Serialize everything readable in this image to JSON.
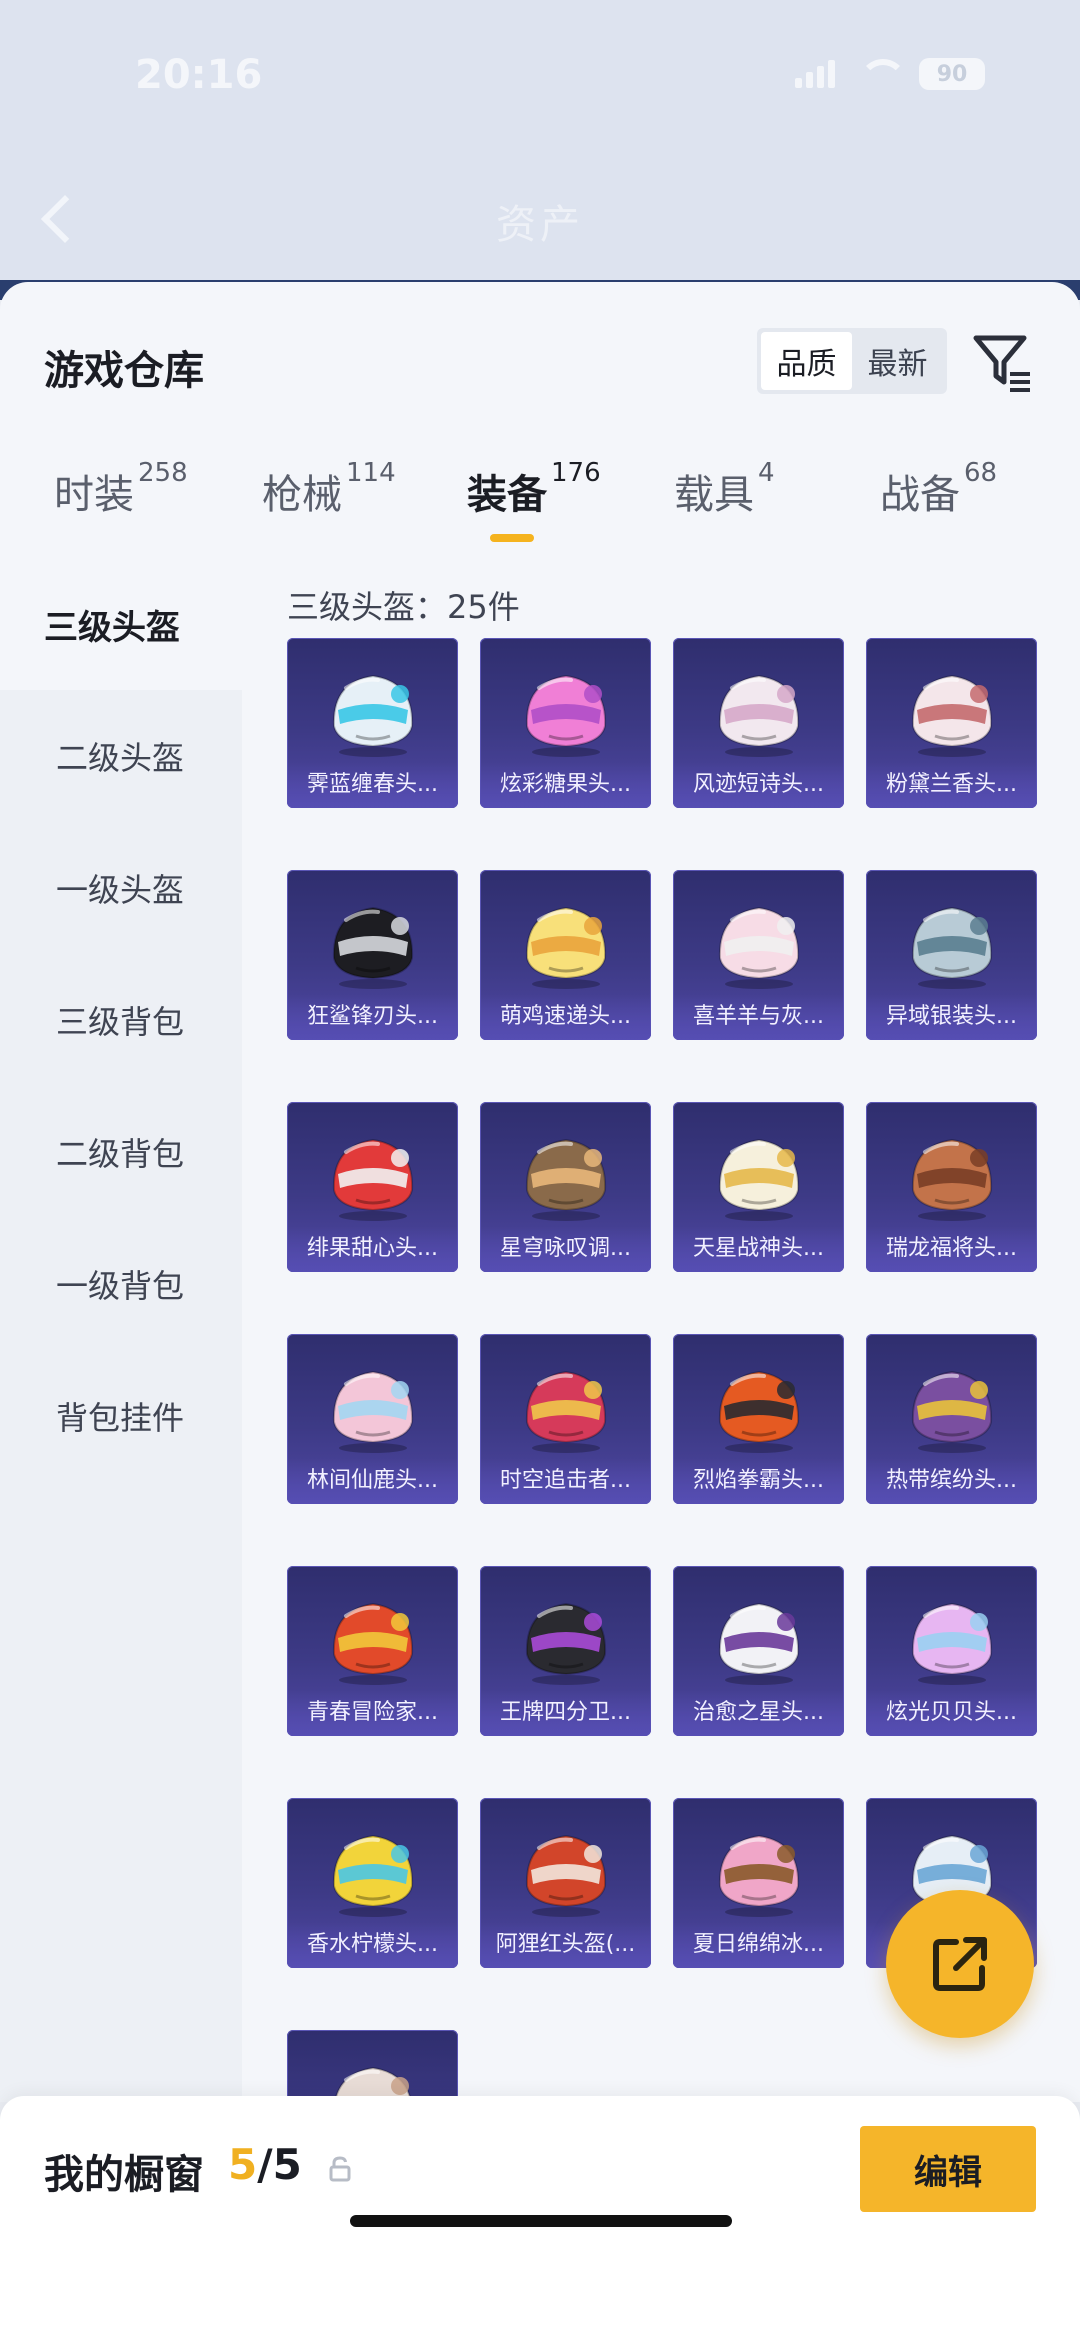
{
  "status_bar": {
    "time": "20:16",
    "battery": "90"
  },
  "app_header": {
    "title": "资产"
  },
  "sheet": {
    "title": "游戏仓库",
    "sort_options": [
      {
        "label": "品质",
        "active": true
      },
      {
        "label": "最新",
        "active": false
      }
    ],
    "filter_icon": "filter-icon"
  },
  "category_tabs": [
    {
      "label": "时装",
      "count": "258",
      "active": false
    },
    {
      "label": "枪械",
      "count": "114",
      "active": false
    },
    {
      "label": "装备",
      "count": "176",
      "active": true
    },
    {
      "label": "载具",
      "count": "4",
      "active": false
    },
    {
      "label": "战备",
      "count": "68",
      "active": false
    }
  ],
  "sidebar": {
    "items": [
      {
        "label": "三级头盔",
        "active": true
      },
      {
        "label": "二级头盔",
        "active": false
      },
      {
        "label": "一级头盔",
        "active": false
      },
      {
        "label": "三级背包",
        "active": false
      },
      {
        "label": "二级背包",
        "active": false
      },
      {
        "label": "一级背包",
        "active": false
      },
      {
        "label": "背包挂件",
        "active": false
      }
    ]
  },
  "section": {
    "header": "三级头盔：25件"
  },
  "items": [
    {
      "name": "霁蓝缠春头...",
      "colors": [
        "#e6f0f7",
        "#39c7e6"
      ]
    },
    {
      "name": "炫彩糖果头...",
      "colors": [
        "#f07fd6",
        "#b04fc8"
      ]
    },
    {
      "name": "风迹短诗头...",
      "colors": [
        "#f2e8ef",
        "#d6a8c9"
      ]
    },
    {
      "name": "粉黛兰香头...",
      "colors": [
        "#f4e6ea",
        "#c46a6e"
      ]
    },
    {
      "name": "狂鲨锋刃头...",
      "colors": [
        "#1d1d22",
        "#d7d9de"
      ]
    },
    {
      "name": "萌鸡速递头...",
      "colors": [
        "#f8e07a",
        "#e9a43c"
      ]
    },
    {
      "name": "喜羊羊与灰...",
      "colors": [
        "#f7dce6",
        "#f0f0f0"
      ]
    },
    {
      "name": "异域银装头...",
      "colors": [
        "#b8cbd6",
        "#5a7e90"
      ]
    },
    {
      "name": "绯果甜心头...",
      "colors": [
        "#e23a3a",
        "#f2f2f2"
      ]
    },
    {
      "name": "星穹咏叹调...",
      "colors": [
        "#8a6a4a",
        "#e8b77a"
      ]
    },
    {
      "name": "天星战神头...",
      "colors": [
        "#f6f0dc",
        "#e6b84a"
      ]
    },
    {
      "name": "瑞龙福将头...",
      "colors": [
        "#c3734a",
        "#7a3e26"
      ]
    },
    {
      "name": "林间仙鹿头...",
      "colors": [
        "#f3c6d8",
        "#a3d6f2"
      ]
    },
    {
      "name": "时空追击者...",
      "colors": [
        "#d63a5a",
        "#f0c84a"
      ]
    },
    {
      "name": "烈焰拳霸头...",
      "colors": [
        "#e55a22",
        "#2a2a30"
      ]
    },
    {
      "name": "热带缤纷头...",
      "colors": [
        "#7a4fa0",
        "#e9c23a"
      ]
    },
    {
      "name": "青春冒险家...",
      "colors": [
        "#e24a2a",
        "#f2c83a"
      ]
    },
    {
      "name": "王牌四分卫...",
      "colors": [
        "#2a2a30",
        "#a94ad8"
      ]
    },
    {
      "name": "治愈之星头...",
      "colors": [
        "#f2f2f6",
        "#6a3a9a"
      ]
    },
    {
      "name": "炫光贝贝头...",
      "colors": [
        "#e7b6f2",
        "#9ad0f2"
      ]
    },
    {
      "name": "香水柠檬头...",
      "colors": [
        "#f2d43a",
        "#4ac7e6"
      ]
    },
    {
      "name": "阿狸红头盔(...",
      "colors": [
        "#d2452a",
        "#f2e6dc"
      ]
    },
    {
      "name": "夏日绵绵冰...",
      "colors": [
        "#f0a6c8",
        "#8a5a2a"
      ]
    },
    {
      "name": "",
      "colors": [
        "#e6eef6",
        "#6aa6d6"
      ]
    },
    {
      "name": "",
      "colors": [
        "#e8dcd6",
        "#c9a28a"
      ]
    }
  ],
  "fab": {
    "icon": "share-icon"
  },
  "bottom_bar": {
    "label": "我的橱窗",
    "count_current": "5",
    "count_total": "/5",
    "edit_label": "编辑"
  },
  "accent_color": "#f5b52a"
}
